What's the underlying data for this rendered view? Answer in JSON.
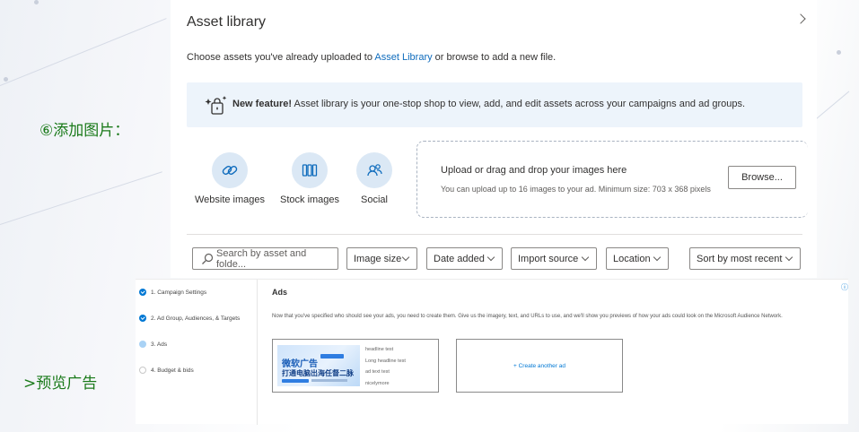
{
  "annotations": {
    "add_images": "⑥添加图片：",
    "preview_ads": ">预览广告"
  },
  "asset_library": {
    "title": "Asset library",
    "intro_before": "Choose assets you've already uploaded to ",
    "intro_link": "Asset Library",
    "intro_after": " or browse to add a new file.",
    "feature_bold": "New feature!",
    "feature_text": " Asset library is your one-stop shop to view, add, and edit assets across your campaigns and ad groups.",
    "sources": [
      {
        "label": "Website images",
        "icon": "link-icon"
      },
      {
        "label": "Stock images",
        "icon": "stock-images-icon"
      },
      {
        "label": "Social",
        "icon": "people-icon"
      }
    ],
    "upload": {
      "title": "Upload or drag and drop your images here",
      "subtitle": "You can upload up to 16 images to your ad. Minimum size: 703 x 368 pixels",
      "browse_label": "Browse..."
    },
    "filters": {
      "search_placeholder": "Search by asset and folde...",
      "image_size": "Image size",
      "date_added": "Date added",
      "import_source": "Import source",
      "location": "Location",
      "sort": "Sort by most recent"
    }
  },
  "preview": {
    "steps": [
      {
        "label": "1. Campaign Settings",
        "state": "done"
      },
      {
        "label": "2. Ad Group, Audiences, & Targets",
        "state": "done"
      },
      {
        "label": "3. Ads",
        "state": "current"
      },
      {
        "label": "4. Budget & bids",
        "state": "todo"
      }
    ],
    "ads_title": "Ads",
    "ads_description": "Now that you've specified who should see your ads, you need to create them. Give us the imagery, text, and URLs to use, and we'll show you previews of how your ads could look on the Microsoft Audience Network.",
    "ad_card": {
      "banner_line1": "微软广告",
      "banner_line2": "打通电脑出海任督二脉",
      "lines": [
        "headline test",
        "Long headline test",
        "ad text test",
        "nicelymore"
      ]
    },
    "create_another": "+ Create another ad"
  },
  "colors": {
    "accent": "#0f6cbd",
    "feature_bg": "#edf4fb",
    "source_circle": "#dbe8f5",
    "annotation_green": "#1a7a1a"
  }
}
